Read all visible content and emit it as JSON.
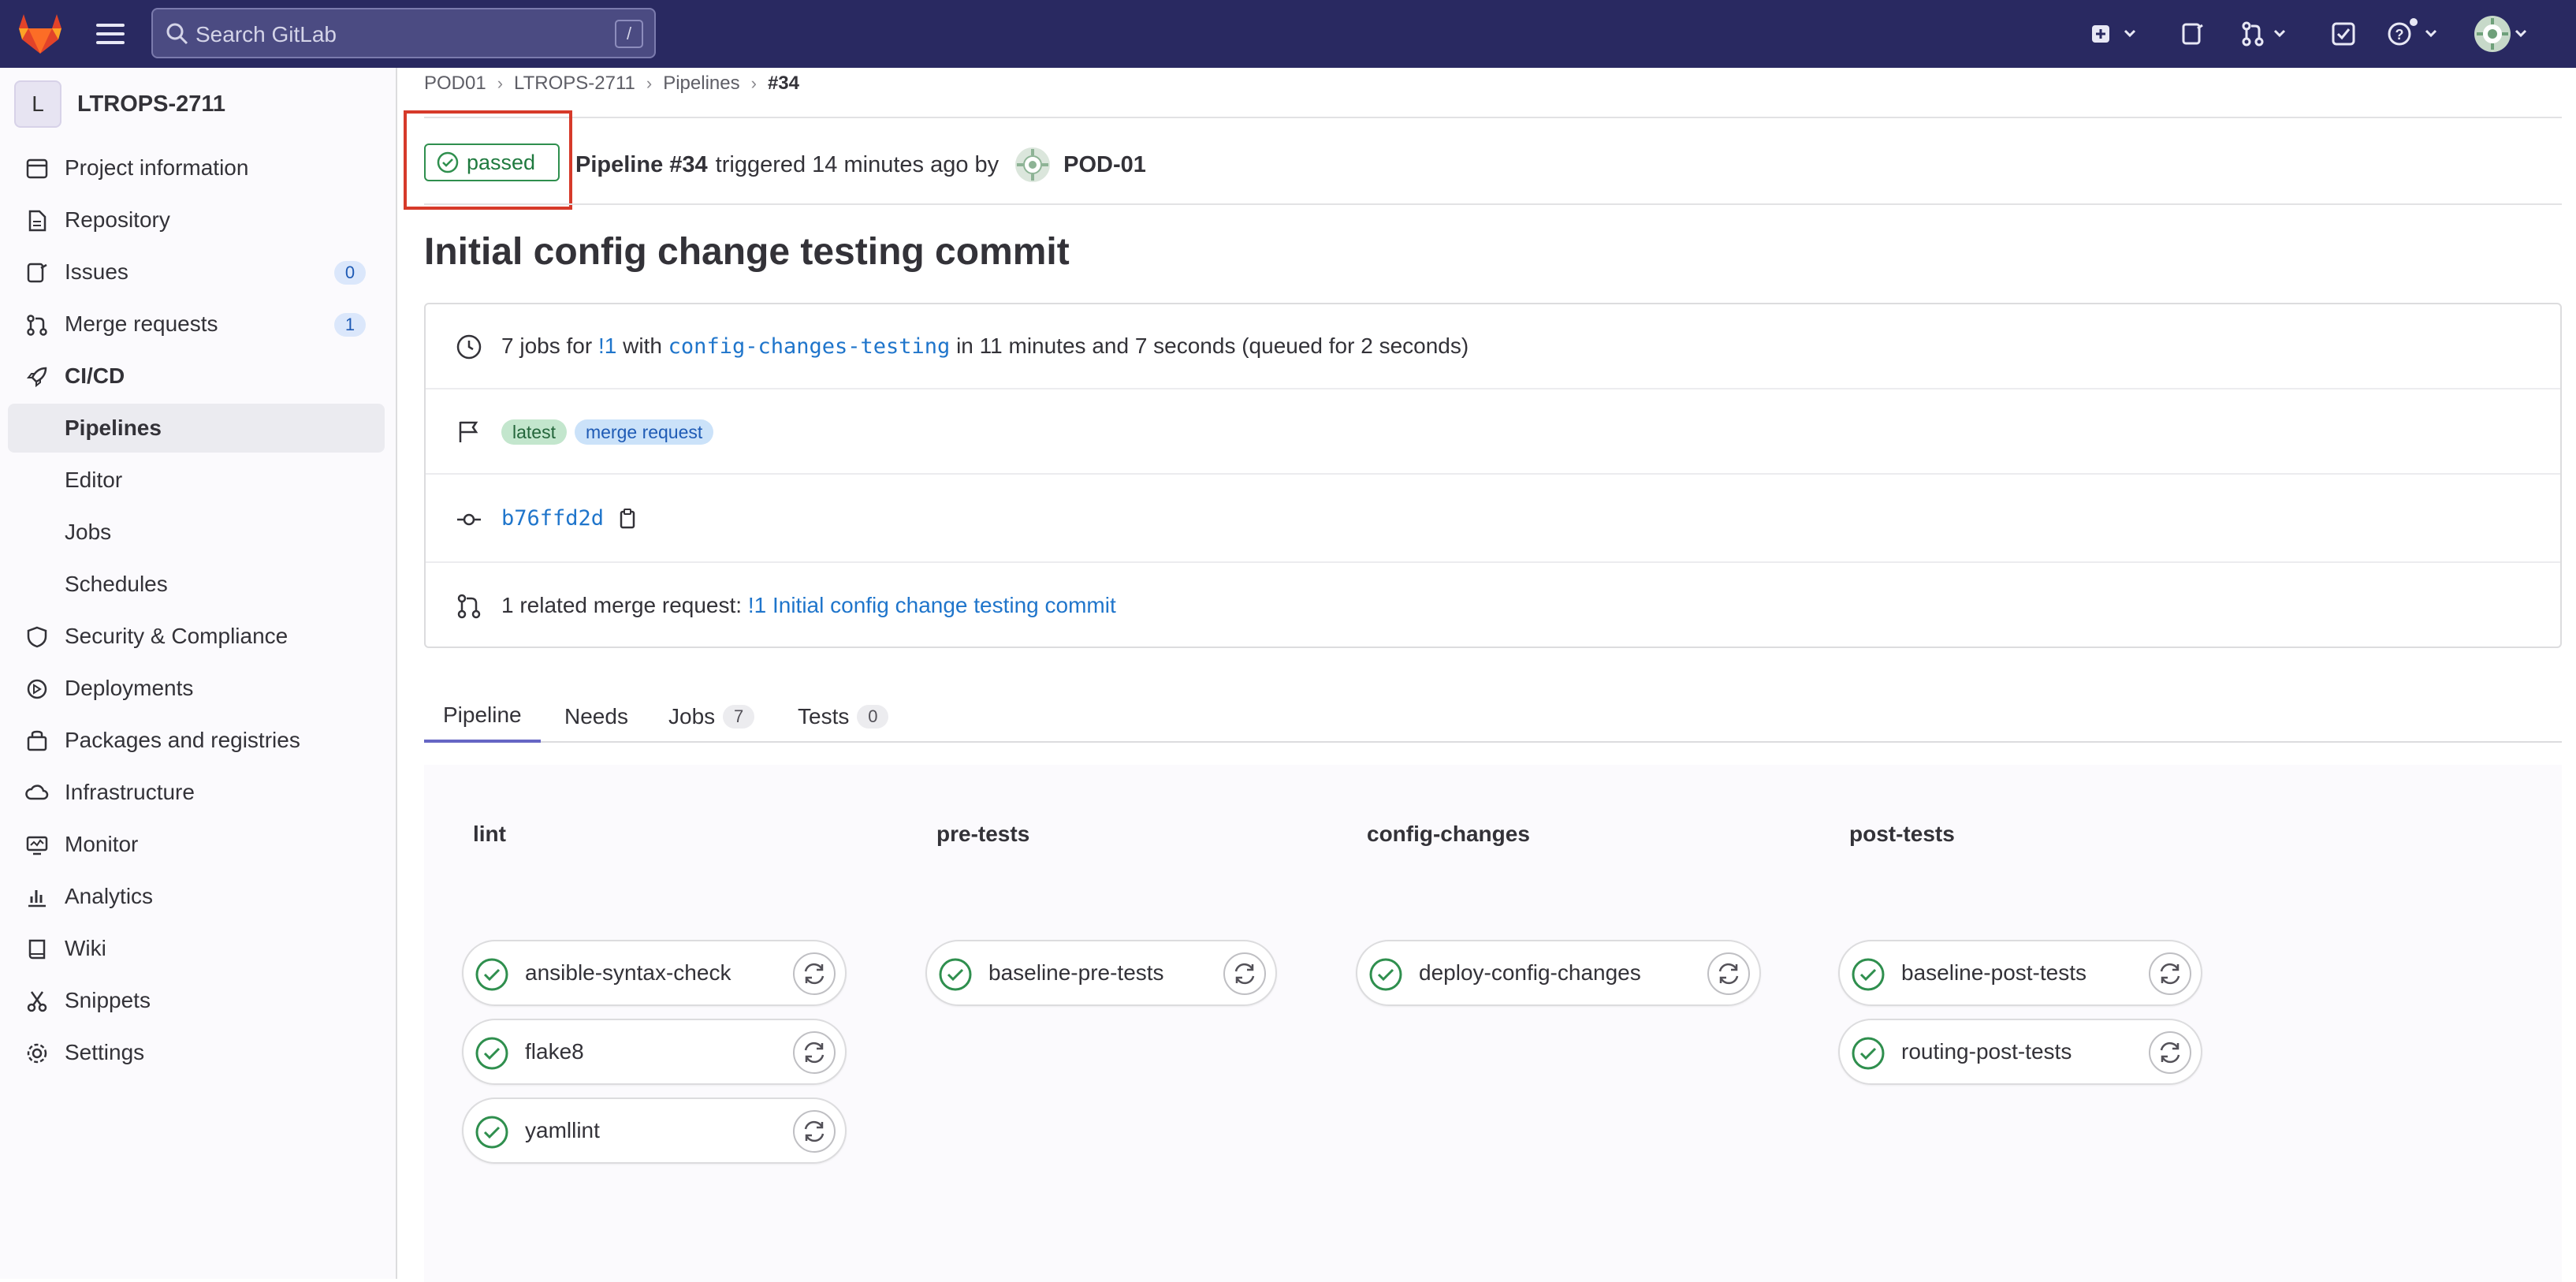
{
  "topbar": {
    "search_placeholder": "Search GitLab",
    "search_shortcut": "/",
    "icons": [
      "tanuki-logo-icon",
      "hamburger-menu-icon",
      "search-icon",
      "create-new-icon",
      "issues-icon",
      "merge-requests-icon",
      "todos-icon",
      "help-icon",
      "user-avatar-icon"
    ],
    "bg_color": "#292961"
  },
  "sidebar": {
    "project_initial": "L",
    "project_name": "LTROPS-2711",
    "items": [
      {
        "label": "Project information",
        "icon": "project-info-icon"
      },
      {
        "label": "Repository",
        "icon": "document-icon"
      },
      {
        "label": "Issues",
        "icon": "issues-icon",
        "count": "0"
      },
      {
        "label": "Merge requests",
        "icon": "merge-request-icon",
        "count": "1"
      },
      {
        "label": "CI/CD",
        "icon": "rocket-icon"
      },
      {
        "label": "Pipelines"
      },
      {
        "label": "Editor"
      },
      {
        "label": "Jobs"
      },
      {
        "label": "Schedules"
      },
      {
        "label": "Security & Compliance",
        "icon": "shield-icon"
      },
      {
        "label": "Deployments",
        "icon": "deployments-icon"
      },
      {
        "label": "Packages and registries",
        "icon": "package-icon"
      },
      {
        "label": "Infrastructure",
        "icon": "cloud-gear-icon"
      },
      {
        "label": "Monitor",
        "icon": "monitor-icon"
      },
      {
        "label": "Analytics",
        "icon": "chart-icon"
      },
      {
        "label": "Wiki",
        "icon": "book-icon"
      },
      {
        "label": "Snippets",
        "icon": "scissors-icon"
      },
      {
        "label": "Settings",
        "icon": "gear-icon"
      }
    ]
  },
  "breadcrumb": [
    "POD01",
    "LTROPS-2711",
    "Pipelines",
    "#34"
  ],
  "pipeline": {
    "status": "passed",
    "name": "Pipeline #34",
    "triggered": "triggered 14 minutes ago by",
    "user": "POD-01",
    "title": "Initial config change testing commit"
  },
  "info": {
    "jobs_prefix": "7 jobs for",
    "mr_ref": "!1",
    "with": "with",
    "branch": "config-changes-testing",
    "duration": "in 11 minutes and 7 seconds (queued for 2 seconds)",
    "tags": [
      "latest",
      "merge request"
    ],
    "commit_sha": "b76ffd2d",
    "related_prefix": "1 related merge request:",
    "related_link": "!1 Initial config change testing commit"
  },
  "tabs": [
    {
      "label": "Pipeline"
    },
    {
      "label": "Needs"
    },
    {
      "label": "Jobs",
      "count": "7"
    },
    {
      "label": "Tests",
      "count": "0"
    }
  ],
  "stages": [
    {
      "name": "lint",
      "jobs": [
        "ansible-syntax-check",
        "flake8",
        "yamllint"
      ]
    },
    {
      "name": "pre-tests",
      "jobs": [
        "baseline-pre-tests"
      ]
    },
    {
      "name": "config-changes",
      "jobs": [
        "deploy-config-changes"
      ]
    },
    {
      "name": "post-tests",
      "jobs": [
        "baseline-post-tests",
        "routing-post-tests"
      ]
    }
  ],
  "colors": {
    "success": "#2f8f4e",
    "link": "#1f75cb",
    "highlight_box": "#d63a2a"
  }
}
